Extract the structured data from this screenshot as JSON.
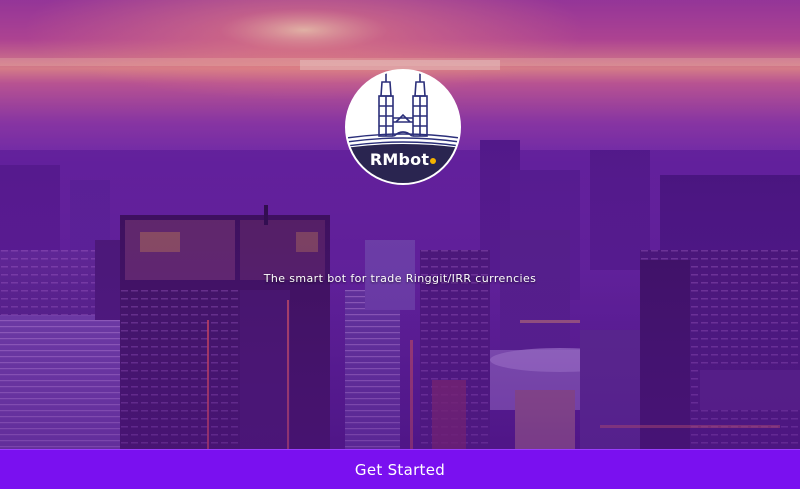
{
  "brand": {
    "name": "RMbot",
    "accent_dot_color": "#f5b300",
    "logo_icon": "twin-towers-icon"
  },
  "tagline": "The smart bot for trade Ringgit/IRR currencies",
  "cta": {
    "label": "Get Started",
    "color": "#7a10f0"
  },
  "background": {
    "description_icon": "city-skyline-icon"
  }
}
